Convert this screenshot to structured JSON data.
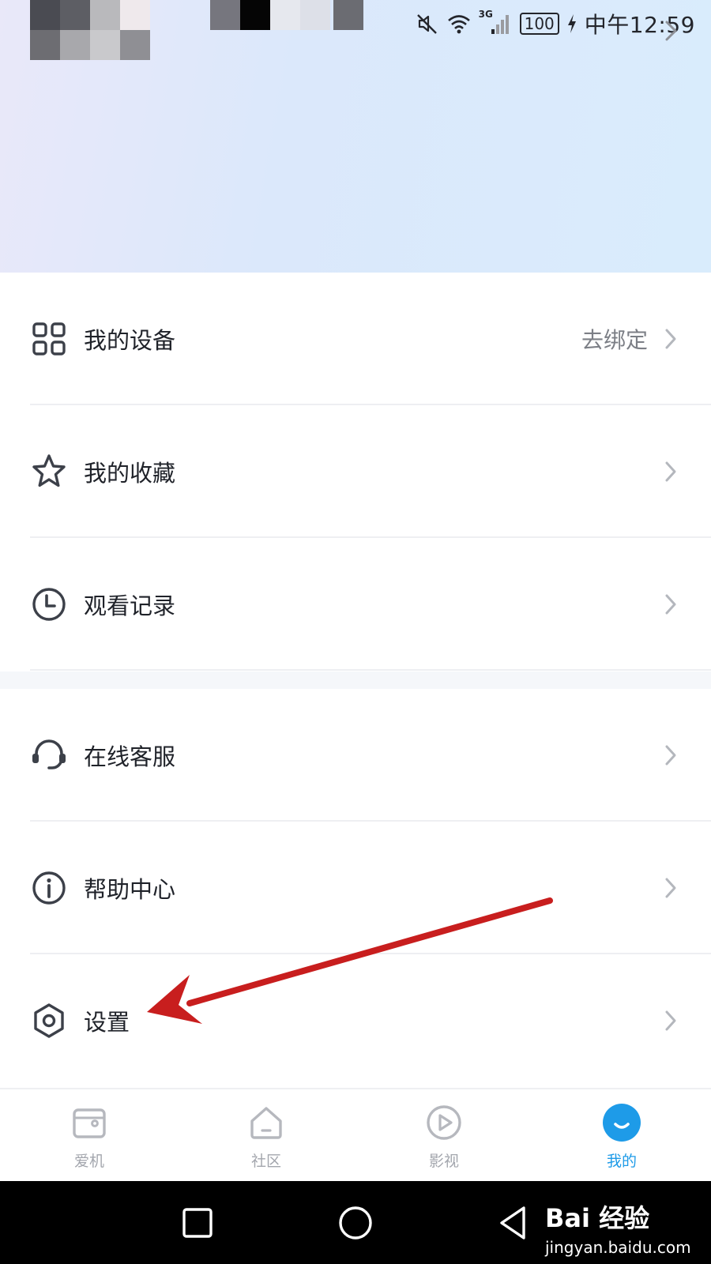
{
  "status_bar": {
    "network": "3G",
    "battery": "100",
    "time": "中午12:59"
  },
  "menu": {
    "group1": [
      {
        "label": "我的设备",
        "trailing": "去绑定",
        "icon": "grid-icon"
      },
      {
        "label": "我的收藏",
        "trailing": "",
        "icon": "star-icon"
      },
      {
        "label": "观看记录",
        "trailing": "",
        "icon": "clock-icon"
      }
    ],
    "group2": [
      {
        "label": "在线客服",
        "trailing": "",
        "icon": "headset-icon"
      },
      {
        "label": "帮助中心",
        "trailing": "",
        "icon": "info-icon"
      },
      {
        "label": "设置",
        "trailing": "",
        "icon": "settings-hexagon-icon"
      }
    ]
  },
  "tabs": [
    {
      "label": "爱机",
      "icon": "device-icon",
      "active": false
    },
    {
      "label": "社区",
      "icon": "home-icon",
      "active": false
    },
    {
      "label": "影视",
      "icon": "play-icon",
      "active": false
    },
    {
      "label": "我的",
      "icon": "smile-icon",
      "active": true
    }
  ],
  "system_nav": {
    "watermark_main": "Bai 经验",
    "watermark_sub": "jingyan.baidu.com"
  },
  "colors": {
    "accent": "#1e9be8",
    "arrow": "#c81e1e",
    "icon": "#3c4049",
    "muted": "#a3a6ad"
  }
}
